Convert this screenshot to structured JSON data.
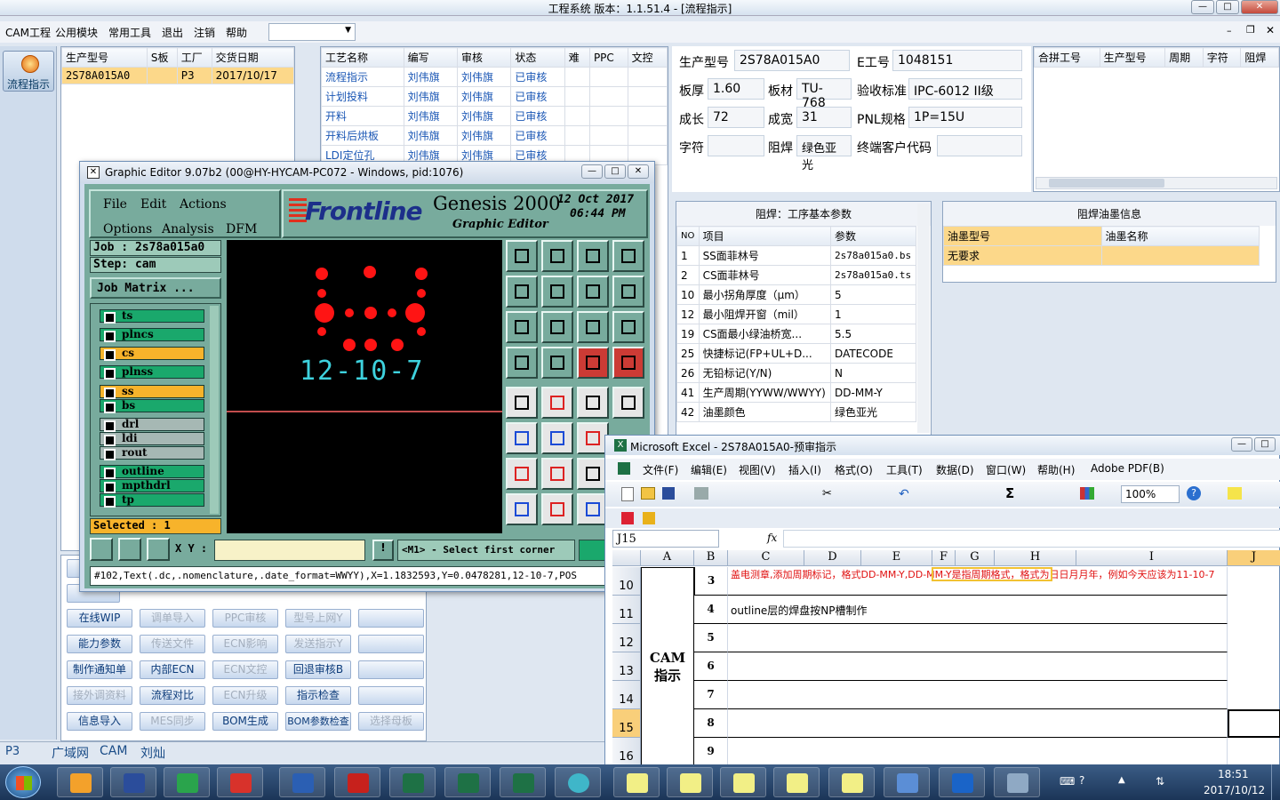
{
  "app": {
    "title": "工程系统   版本：1.1.51.4 - [流程指示]"
  },
  "menubar": {
    "items": [
      "CAM工程",
      "公用模块",
      "常用工具",
      "退出",
      "注销",
      "帮助"
    ]
  },
  "sidebar": {
    "button_label": "流程指示"
  },
  "order_table": {
    "headers": [
      "生产型号",
      "S板",
      "工厂",
      "交货日期"
    ],
    "rows": [
      [
        "2S78A015A0",
        "",
        "P3",
        "2017/10/17"
      ]
    ]
  },
  "process_table": {
    "headers": [
      "工艺名称",
      "编写",
      "审核",
      "状态",
      "难",
      "PPC",
      "文控"
    ],
    "rows": [
      [
        "流程指示",
        "刘伟旗",
        "刘伟旗",
        "已审核"
      ],
      [
        "计划投料",
        "刘伟旗",
        "刘伟旗",
        "已审核"
      ],
      [
        "开料",
        "刘伟旗",
        "刘伟旗",
        "已审核"
      ],
      [
        "开料后烘板",
        "刘伟旗",
        "刘伟旗",
        "已审核"
      ],
      [
        "LDI定位孔",
        "刘伟旗",
        "刘伟旗",
        "已审核"
      ]
    ]
  },
  "info": {
    "model_label": "生产型号",
    "model": "2S78A015A0",
    "e_label": "E工号",
    "e_no": "1048151",
    "thick_label": "板厚",
    "thick": "1.60",
    "material_label": "板材",
    "material": "TU-768",
    "std_label": "验收标准",
    "std": "IPC-6012 II级",
    "len_label": "成长",
    "len": "72",
    "wid_label": "成宽",
    "wid": "31",
    "pnl_label": "PNL规格",
    "pnl": "1P=15U",
    "char_label": "字符",
    "char": "",
    "mask_label": "阻焊",
    "mask": "绿色亚光",
    "cust_label": "终端客户代码",
    "cust": ""
  },
  "merge_table": {
    "headers": [
      "合拼工号",
      "生产型号",
      "周期",
      "字符",
      "阻焊"
    ]
  },
  "params": {
    "title": "阻焊：工序基本参数",
    "headers": [
      "NO",
      "项目",
      "参数"
    ],
    "rows": [
      [
        "1",
        "SS面菲林号",
        "2s78a015a0.bs"
      ],
      [
        "2",
        "CS面菲林号",
        "2s78a015a0.ts"
      ],
      [
        "10",
        "最小拐角厚度（μm）",
        "5"
      ],
      [
        "12",
        "最小阻焊开窗（mil）",
        "1"
      ],
      [
        "19",
        "CS面最小绿油桥宽...",
        "5.5"
      ],
      [
        "25",
        "快捷标记(FP+UL+D...",
        "DATECODE"
      ],
      [
        "26",
        "无铅标记(Y/N)",
        "N"
      ],
      [
        "41",
        "生产周期(YYWW/WWYY)",
        "DD-MM-Y"
      ],
      [
        "42",
        "油墨颜色",
        "绿色亚光"
      ]
    ]
  },
  "ink": {
    "title": "阻焊油墨信息",
    "headers": [
      "油墨型号",
      "油墨名称"
    ],
    "rows": [
      [
        "无要求",
        ""
      ]
    ]
  },
  "buttons": [
    [
      "在线WIP",
      "调单导入",
      "PPC审核",
      "型号上网Y",
      ""
    ],
    [
      "能力参数",
      "传送文件",
      "ECN影响",
      "发送指示Y",
      ""
    ],
    [
      "制作通知单",
      "内部ECN",
      "ECN文控",
      "回退审核B",
      ""
    ],
    [
      "接外调资料",
      "流程对比",
      "ECN升级",
      "指示检查",
      ""
    ],
    [
      "信息导入",
      "MES同步",
      "BOM生成",
      "BOM参数检查",
      "选择母板"
    ]
  ],
  "statusbar": {
    "items": [
      "P3",
      "广域网",
      "CAM",
      "刘灿"
    ]
  },
  "genesis": {
    "title": "Graphic Editor 9.07b2 (00@HY-HYCAM-PC072 - Windows, pid:1076)",
    "menu": [
      "File",
      "Edit",
      "Actions",
      "Options",
      "Analysis",
      "DFM"
    ],
    "brand": "Frontline",
    "product": "Genesis 2000",
    "subtitle": "Graphic Editor",
    "date": "12 Oct 2017",
    "time": "06:44 PM",
    "job": "Job  : 2s78a015a0",
    "step": "Step: cam",
    "job_matrix": "Job Matrix ...",
    "layers": [
      "ts",
      "plncs",
      "cs",
      "plnss",
      "ss",
      "bs",
      "drl",
      "ldi",
      "rout",
      "outline",
      "mpthdrl",
      "tp"
    ],
    "selected": "Selected : 1",
    "xy_label": "X Y :",
    "prompt": "<M1> - Select first corner",
    "command": "#102,Text(.dc,.nomenclature,.date_format=WWYY),X=1.1832593,Y=0.0478281,12-10-7,POS",
    "canvas_text": "12-10-7"
  },
  "excel": {
    "title": "Microsoft Excel - 2S78A015A0-预审指示",
    "menu": [
      "文件(F)",
      "编辑(E)",
      "视图(V)",
      "插入(I)",
      "格式(O)",
      "工具(T)",
      "数据(D)",
      "窗口(W)",
      "帮助(H)",
      "Adobe PDF(B)"
    ],
    "zoom": "100%",
    "namebox": "J15",
    "fx": "fx",
    "columns": [
      "A",
      "B",
      "C",
      "D",
      "E",
      "F",
      "G",
      "H",
      "I",
      "J"
    ],
    "section": "CAM\n指示",
    "rows": [
      {
        "row": "10",
        "n": "3",
        "text": "盖电测章,添加周期标记，格式DD-MM-Y,DD-MM-Y是指周期格式，格式为日日月月年，例如今天应该为11-10-7"
      },
      {
        "row": "11",
        "n": "4",
        "text": "outline层的焊盘按NP槽制作"
      },
      {
        "row": "12",
        "n": "5",
        "text": ""
      },
      {
        "row": "13",
        "n": "6",
        "text": ""
      },
      {
        "row": "14",
        "n": "7",
        "text": ""
      },
      {
        "row": "15",
        "n": "8",
        "text": ""
      },
      {
        "row": "16",
        "n": "9",
        "text": ""
      }
    ]
  },
  "taskbar": {
    "clock": "18:51",
    "date": "2017/10/12"
  }
}
